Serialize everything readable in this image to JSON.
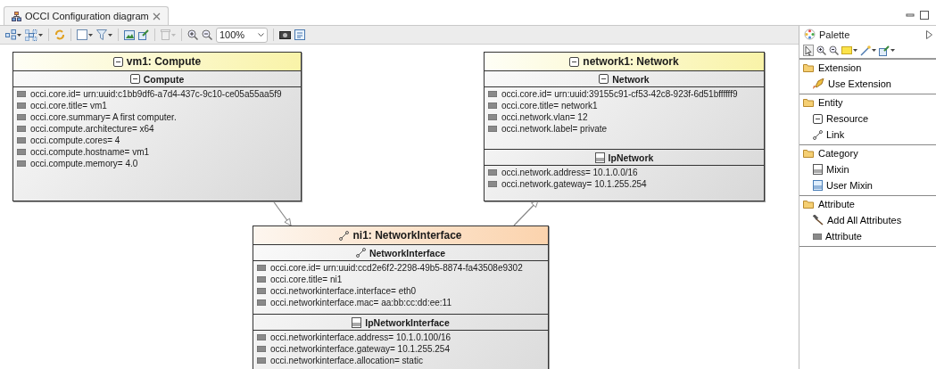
{
  "editor_tab": {
    "title": "OCCI Configuration diagram",
    "selected": true
  },
  "toolbar": {
    "zoom": "100%"
  },
  "diagram": {
    "nodes": [
      {
        "kind": "resource",
        "title": "vm1: Compute",
        "compartments": [
          {
            "kind": "kind",
            "name": "Compute",
            "attributes": [
              "occi.core.id= urn:uuid:c1bb9df6-a7d4-437c-9c10-ce05a55aa5f9",
              "occi.core.title= vm1",
              "occi.core.summary= A first computer.",
              "occi.compute.architecture= x64",
              "occi.compute.cores= 4",
              "occi.compute.hostname= vm1",
              "occi.compute.memory= 4.0"
            ]
          }
        ]
      },
      {
        "kind": "resource",
        "title": "network1: Network",
        "compartments": [
          {
            "kind": "kind",
            "name": "Network",
            "attributes": [
              "occi.core.id= urn:uuid:39155c91-cf53-42c8-923f-6d51bffffff9",
              "occi.core.title= network1",
              "occi.network.vlan= 12",
              "occi.network.label= private"
            ]
          },
          {
            "kind": "mixin",
            "name": "IpNetwork",
            "attributes": [
              "occi.network.address= 10.1.0.0/16",
              "occi.network.gateway= 10.1.255.254"
            ]
          }
        ]
      },
      {
        "kind": "link",
        "title": "ni1: NetworkInterface",
        "compartments": [
          {
            "kind": "link",
            "name": "NetworkInterface",
            "attributes": [
              "occi.core.id= urn:uuid:ccd2e6f2-2298-49b5-8874-fa43508e9302",
              "occi.core.title= ni1",
              "occi.networkinterface.interface= eth0",
              "occi.networkinterface.mac= aa:bb:cc:dd:ee:11"
            ]
          },
          {
            "kind": "mixin",
            "name": "IpNetworkInterface",
            "attributes": [
              "occi.networkinterface.address= 10.1.0.100/16",
              "occi.networkinterface.gateway= 10.1.255.254",
              "occi.networkinterface.allocation= static"
            ]
          }
        ]
      }
    ]
  },
  "palette": {
    "title": "Palette",
    "groups": [
      {
        "label": "Extension",
        "items": [
          {
            "kind": "extension",
            "label": "Use Extension"
          }
        ]
      },
      {
        "label": "Entity",
        "items": [
          {
            "kind": "resource",
            "label": "Resource"
          },
          {
            "kind": "link",
            "label": "Link"
          }
        ]
      },
      {
        "label": "Category",
        "items": [
          {
            "kind": "mixin",
            "label": "Mixin"
          },
          {
            "kind": "user-mixin",
            "label": "User Mixin"
          }
        ]
      },
      {
        "label": "Attribute",
        "items": [
          {
            "kind": "add-attributes",
            "label": "Add All Attributes"
          },
          {
            "kind": "attribute",
            "label": "Attribute"
          }
        ]
      }
    ]
  }
}
